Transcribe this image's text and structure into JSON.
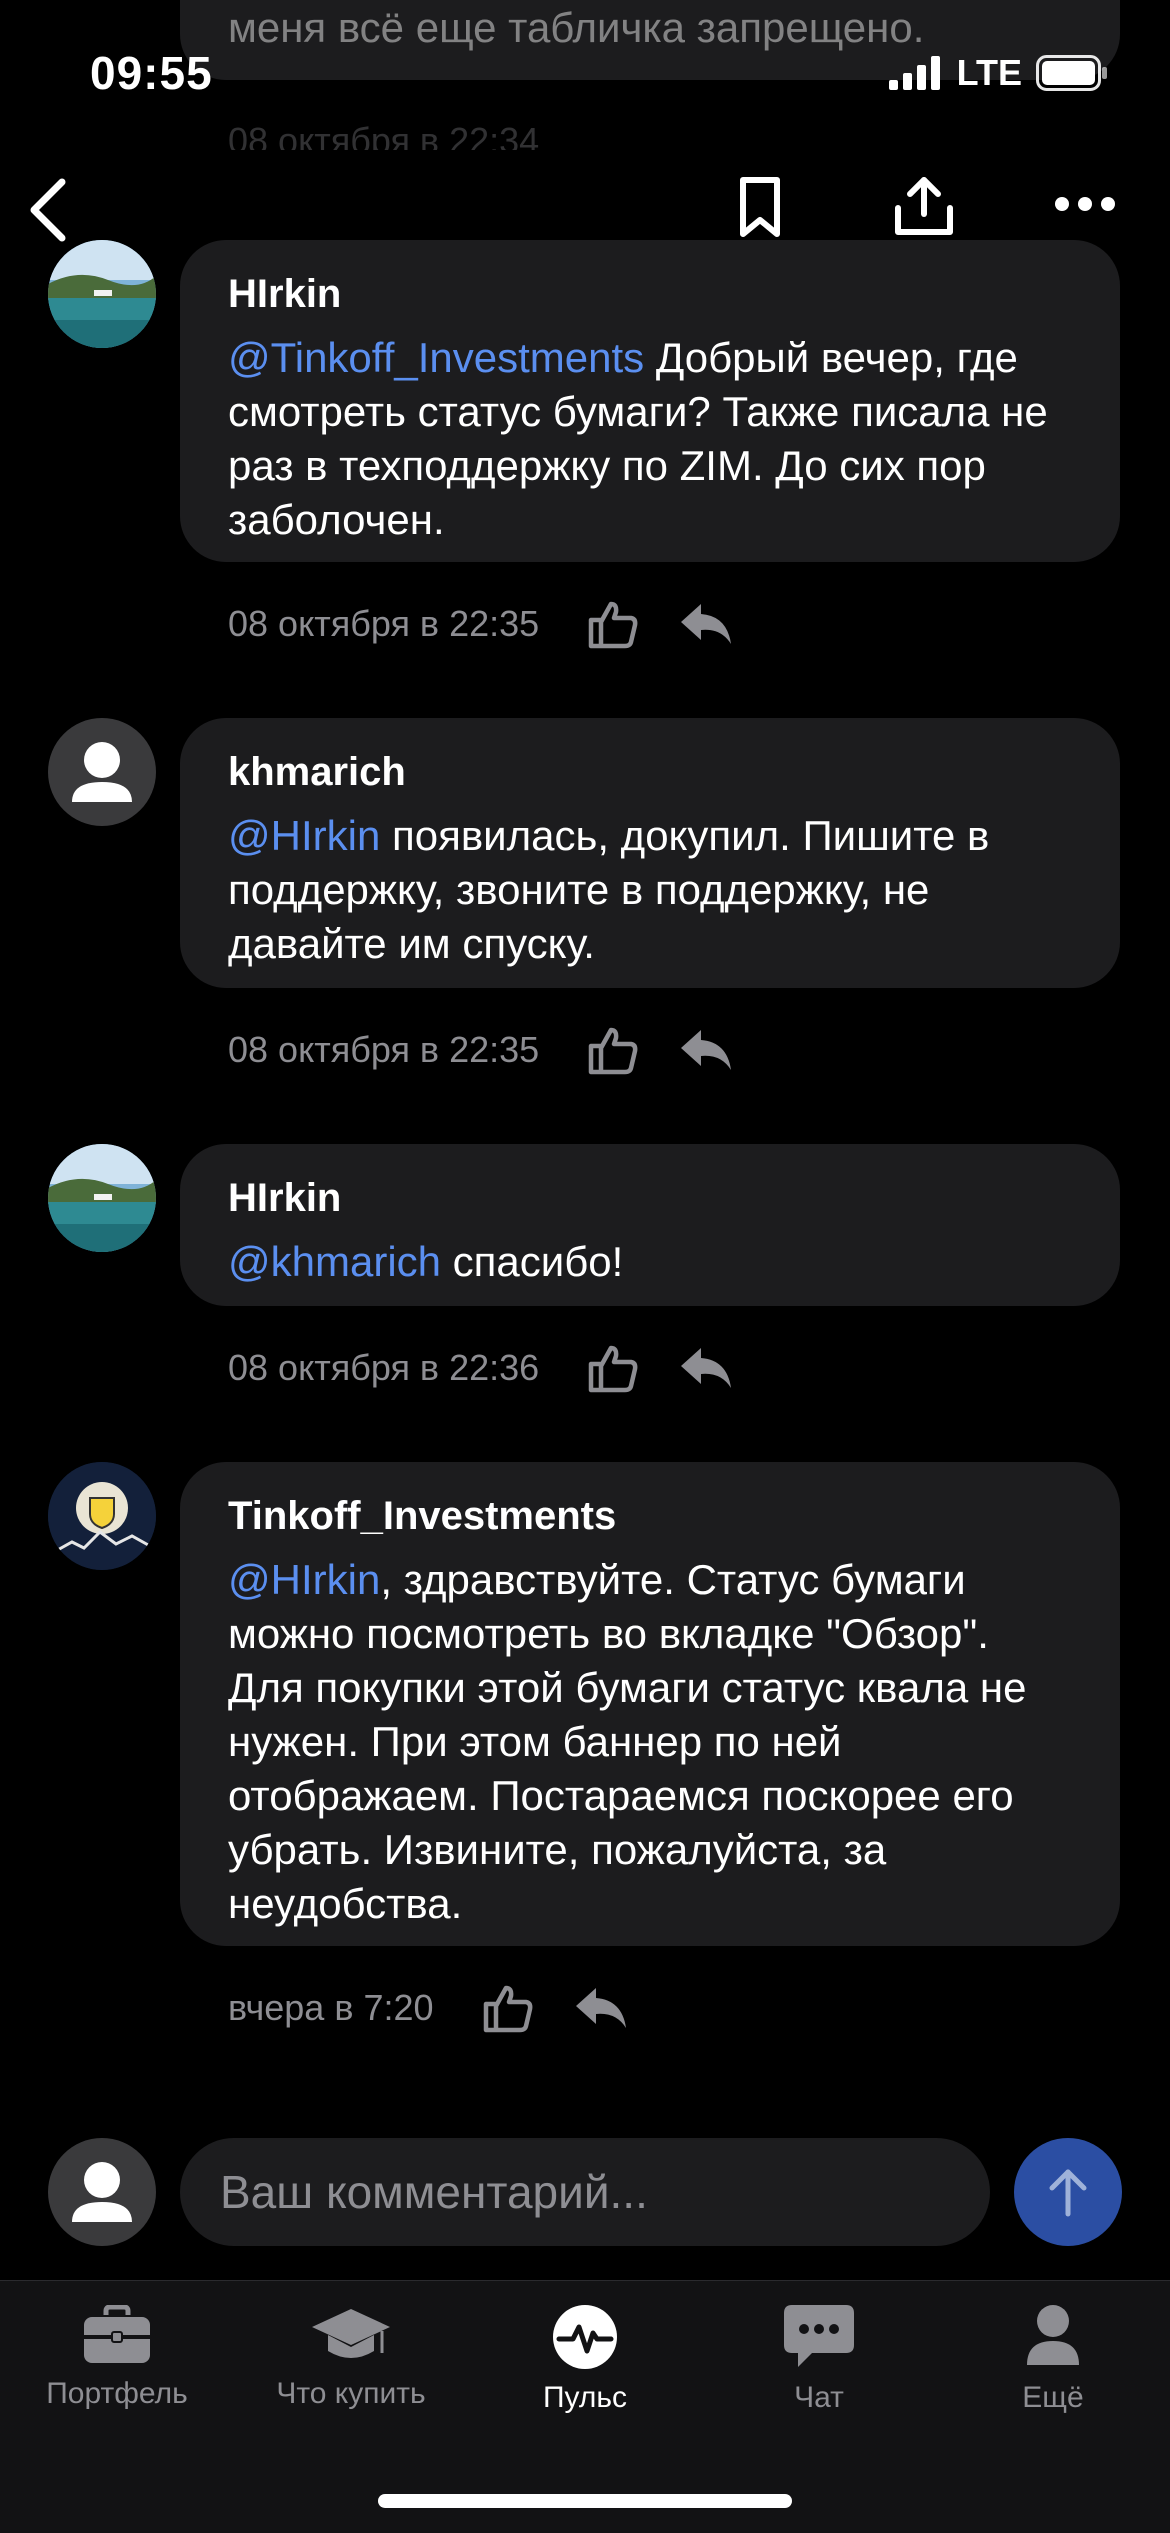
{
  "status_bar": {
    "time": "09:55",
    "network": "LTE"
  },
  "top_partial": {
    "text": "меня всё еще табличка запрещено.",
    "date": "08 октября в 22:34"
  },
  "comments": [
    {
      "author": "HIrkin",
      "mention": "@Tinkoff_Investments",
      "text": " Добрый вечер, где смотреть статус бумаги? Также писала не раз в техподдержку по ZIM. До сих пор заболочен.",
      "date": "08 октября в 22:35",
      "avatar": "lake-photo"
    },
    {
      "author": "khmarich",
      "mention": "@HIrkin",
      "text": " появилась, докупил. Пишите в поддержку, звоните в поддержку, не давайте им спуску.",
      "date": "08 октября в 22:35",
      "avatar": "default-user"
    },
    {
      "author": "HIrkin",
      "mention": "@khmarich",
      "text": " спасибо!",
      "date": "08 октября в 22:36",
      "avatar": "lake-photo"
    },
    {
      "author": "Tinkoff_Investments",
      "mention": "@HIrkin",
      "text": ", здравствуйте. Статус бумаги можно посмотреть во вкладке \"Обзор\". Для покупки этой бумаги статус квала не нужен. При этом баннер по ней отображаем. Постараемся поскорее его убрать. Извините, пожалуйста, за неудобства.",
      "date": "вчера в 7:20",
      "avatar": "tinkoff-logo"
    }
  ],
  "composer": {
    "placeholder": "Ваш комментарий..."
  },
  "tabbar": {
    "items": [
      {
        "label": "Портфель",
        "icon": "briefcase-icon",
        "active": false
      },
      {
        "label": "Что купить",
        "icon": "graduation-cap-icon",
        "active": false
      },
      {
        "label": "Пульс",
        "icon": "pulse-icon",
        "active": true
      },
      {
        "label": "Чат",
        "icon": "chat-icon",
        "active": false
      },
      {
        "label": "Ещё",
        "icon": "profile-icon",
        "active": false
      }
    ]
  },
  "colors": {
    "background": "#000000",
    "bubble": "#1c1c1e",
    "mention": "#5b8ff0",
    "muted": "#8e8e93",
    "send_button": "#2b4ea3"
  }
}
